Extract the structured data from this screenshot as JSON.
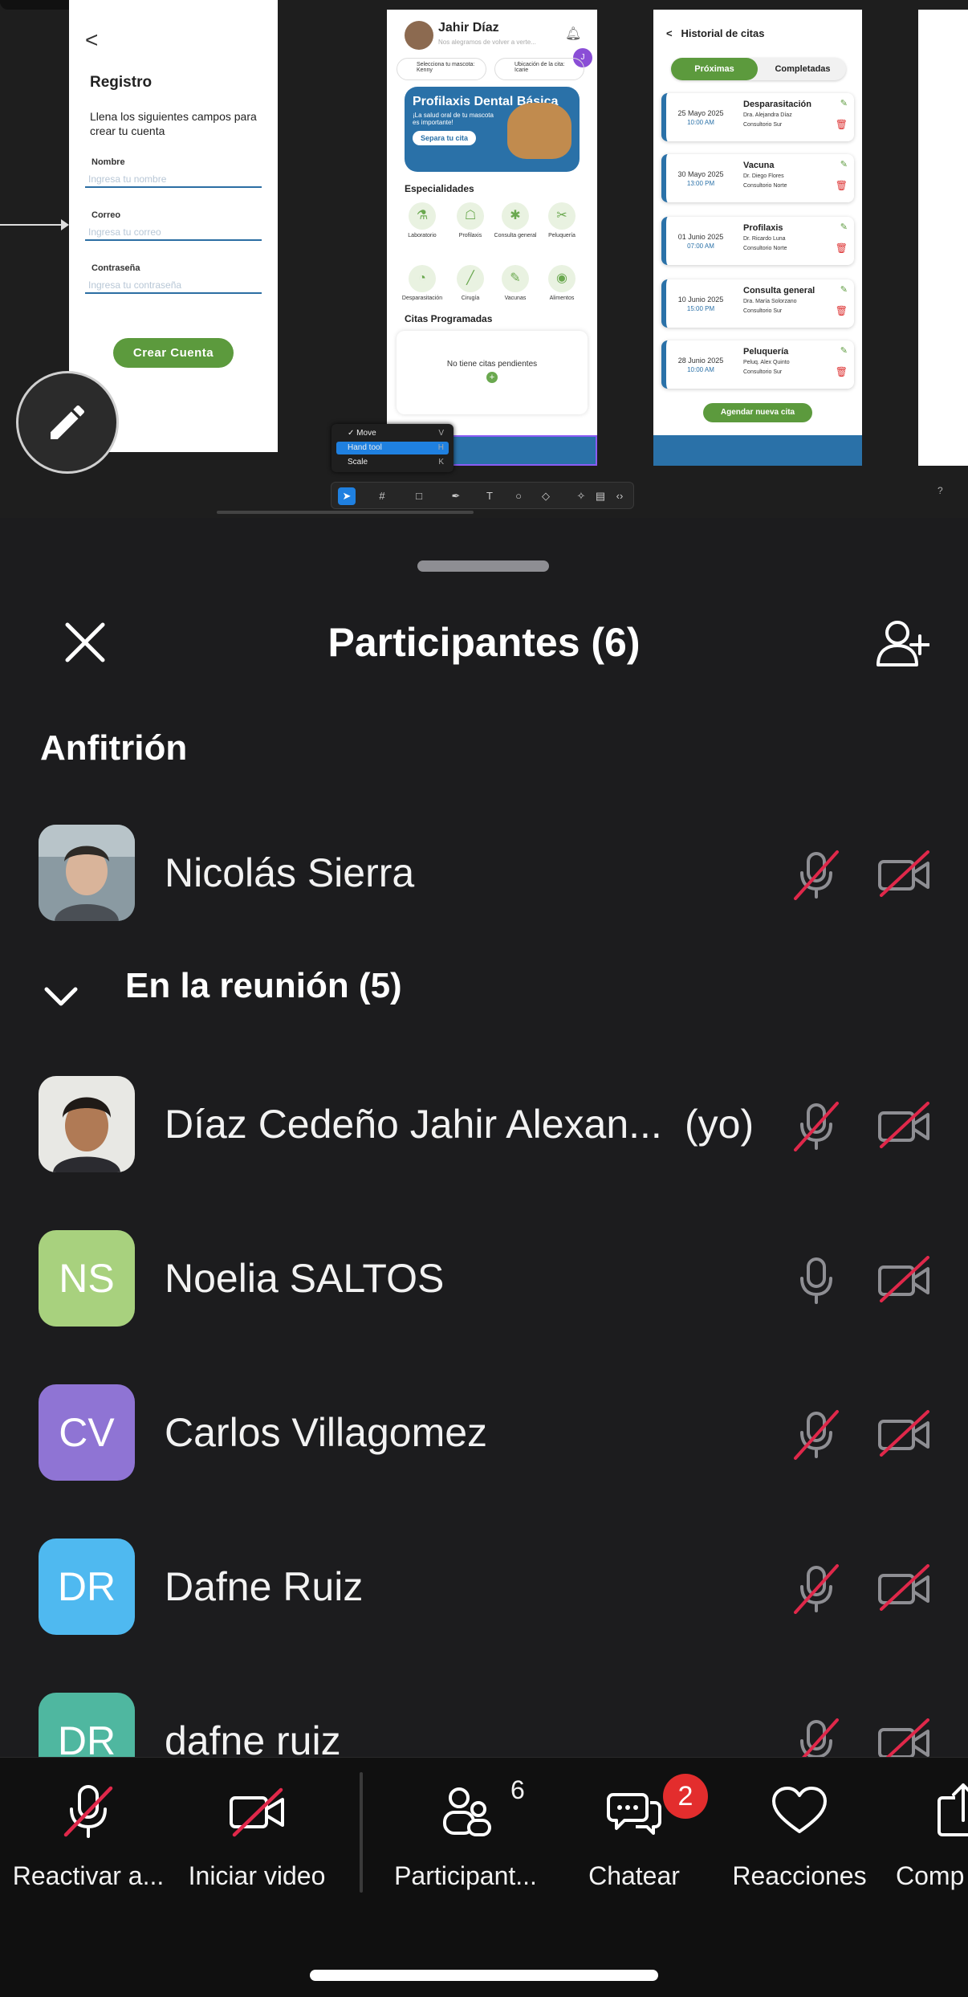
{
  "shared_screen": {
    "registro": {
      "back": "<",
      "title": "Registro",
      "subtitle": "Llena los siguientes campos para crear tu cuenta",
      "fields": [
        {
          "label": "Nombre",
          "placeholder": "Ingresa tu nombre"
        },
        {
          "label": "Correo",
          "placeholder": "Ingresa tu correo"
        },
        {
          "label": "Contraseña",
          "placeholder": "Ingresa tu contraseña"
        }
      ],
      "cta": "Crear Cuenta"
    },
    "home": {
      "user_name": "Jahir Díaz",
      "user_sub": "Nos alegramos de volver a verte...",
      "badge": "J",
      "pet_select": {
        "label": "Selecciona tu mascota:",
        "value": "Kenny"
      },
      "location_select": {
        "label": "Ubicación de la cita:",
        "value": "Icarie"
      },
      "banner": {
        "title": "Profilaxis Dental Básica",
        "subtitle": "¡La salud oral de tu mascota es importante!",
        "button": "Separa tu cita"
      },
      "specialties_title": "Especialidades",
      "specialties": [
        "Laboratorio",
        "Profilaxis",
        "Consulta general",
        "Peluquería",
        "Desparasitación",
        "Cirugía",
        "Vacunas",
        "Alimentos"
      ],
      "scheduled_title": "Citas Programadas",
      "no_appointments": "No tiene citas pendientes"
    },
    "historial": {
      "title": "Historial de citas",
      "tab_active": "Próximas",
      "tab_inactive": "Completadas",
      "appointments": [
        {
          "date": "25 Mayo 2025",
          "time": "10:00 AM",
          "name": "Desparasitación",
          "doctor": "Dra. Alejandra Díaz",
          "place": "Consultorio Sur"
        },
        {
          "date": "30 Mayo 2025",
          "time": "13:00 PM",
          "name": "Vacuna",
          "doctor": "Dr. Diego Flores",
          "place": "Consultorio Norte"
        },
        {
          "date": "01 Junio 2025",
          "time": "07:00 AM",
          "name": "Profilaxis",
          "doctor": "Dr. Ricardo Luna",
          "place": "Consultorio Norte"
        },
        {
          "date": "10 Junio 2025",
          "time": "15:00 PM",
          "name": "Consulta general",
          "doctor": "Dra. María Solorzano",
          "place": "Consultorio Sur"
        },
        {
          "date": "28 Junio 2025",
          "time": "10:00 AM",
          "name": "Peluquería",
          "doctor": "Peluq. Alex Quinto",
          "place": "Consultorio Sur"
        }
      ],
      "cta": "Agendar nueva cita"
    },
    "tool_menu": [
      {
        "label": "Move",
        "key": "V",
        "checked": true
      },
      {
        "label": "Hand tool",
        "key": "H",
        "active": true
      },
      {
        "label": "Scale",
        "key": "K"
      }
    ],
    "help": "?"
  },
  "participants_panel": {
    "title": "Participantes (6)",
    "host_section": "Anfitrión",
    "meeting_section": "En la reunión (5)",
    "host": {
      "name": "Nicolás Sierra",
      "muted": true,
      "video_off": true
    },
    "participants": [
      {
        "name": "Díaz Cedeño Jahir Alexan...",
        "suffix": "(yo)",
        "initials": "",
        "avatar_color": "#6b5a4a",
        "muted": true,
        "video_off": true
      },
      {
        "name": "Noelia SALTOS",
        "initials": "NS",
        "avatar_color": "#a8d17e",
        "muted": false,
        "video_off": true
      },
      {
        "name": "Carlos Villagomez",
        "initials": "CV",
        "avatar_color": "#8f74d4",
        "muted": true,
        "video_off": true
      },
      {
        "name": "Dafne Ruiz",
        "initials": "DR",
        "avatar_color": "#4fb9f0",
        "muted": true,
        "video_off": true
      },
      {
        "name": "dafne ruiz",
        "initials": "DR",
        "avatar_color": "#4fb7a0",
        "muted": true,
        "video_off": true
      }
    ]
  },
  "toolbar": {
    "items": [
      {
        "label": "Reactivar a...",
        "icon": "mic-off-icon"
      },
      {
        "label": "Iniciar video",
        "icon": "video-off-icon"
      },
      {
        "label": "Participant...",
        "icon": "participants-icon",
        "count": "6"
      },
      {
        "label": "Chatear",
        "icon": "chat-icon",
        "badge": "2"
      },
      {
        "label": "Reacciones",
        "icon": "heart-icon"
      },
      {
        "label": "Comp",
        "icon": "share-icon"
      }
    ]
  },
  "colors": {
    "accent_red": "#e32d2d",
    "muted_slash": "#e0284a",
    "background": "#1c1c1e"
  }
}
